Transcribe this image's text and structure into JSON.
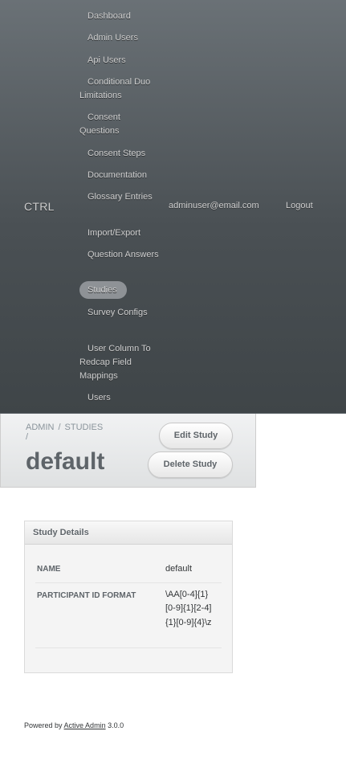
{
  "header": {
    "site_title": "CTRL",
    "nav_items": [
      {
        "label": "Dashboard"
      },
      {
        "label": "Admin Users"
      },
      {
        "label": "Api Users"
      },
      {
        "label": "Conditional Duo Limitations"
      },
      {
        "label": "Consent Questions"
      },
      {
        "label": "Consent Steps"
      },
      {
        "label": "Documentation"
      },
      {
        "label": "Glossary Entries"
      },
      {
        "label": "Import/Export"
      },
      {
        "label": "Question Answers"
      },
      {
        "label": "Studies",
        "current": true
      },
      {
        "label": "Survey Configs"
      },
      {
        "label": "User Column To Redcap Field Mappings"
      },
      {
        "label": "Users"
      }
    ],
    "user_email": "adminuser@email.com",
    "logout_label": "Logout"
  },
  "title_bar": {
    "breadcrumb": [
      "ADMIN",
      "STUDIES"
    ],
    "breadcrumb_separator": "/",
    "page_title": "default",
    "edit_button": "Edit Study",
    "delete_button": "Delete Study"
  },
  "panel": {
    "title": "Study Details",
    "rows": [
      {
        "label": "NAME",
        "value": "default"
      },
      {
        "label": "PARTICIPANT ID FORMAT",
        "value": "\\AA[0-4]{1}[0-9]{1}[2-4]{1}[0-9]{4}\\z"
      }
    ]
  },
  "footer": {
    "powered_by": "Powered by",
    "link_text": "Active Admin",
    "version": "3.0.0"
  },
  "colors": {
    "header_bg": "#4d5357",
    "current_nav_bg": "#8e9296",
    "title_bar_bg": "#e6e8e9"
  }
}
